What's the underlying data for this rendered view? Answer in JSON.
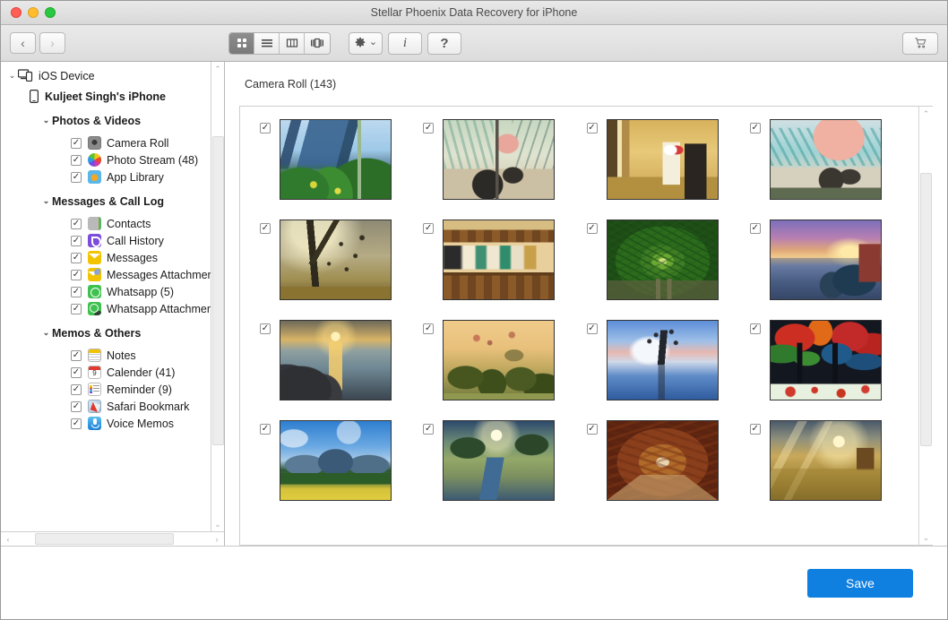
{
  "window": {
    "title": "Stellar Phoenix Data Recovery for iPhone",
    "traffic_lights": [
      "close-red",
      "minimize-yellow",
      "maximize-green"
    ]
  },
  "toolbar": {
    "back_label": "‹",
    "forward_label": "›",
    "view_modes": [
      {
        "name": "icon-view",
        "icon": "grid-icon",
        "active": true
      },
      {
        "name": "list-view",
        "icon": "list-icon",
        "active": false
      },
      {
        "name": "column-view",
        "icon": "columns-icon",
        "active": false
      },
      {
        "name": "gallery-view",
        "icon": "coverflow-icon",
        "active": false
      }
    ],
    "gear_label": "⚙",
    "gear_chevron": "⌄",
    "info_label": "i",
    "help_label": "?",
    "cart_icon": "shopping-cart-icon"
  },
  "sidebar": {
    "root": {
      "label": "iOS Device",
      "icon": "devices-icon",
      "disclosure": "⌄"
    },
    "device": {
      "label": "Kuljeet Singh's iPhone",
      "icon": "iphone-icon"
    },
    "groups": [
      {
        "label": "Photos & Videos",
        "disclosure": "⌄",
        "items": [
          {
            "label": "Camera Roll",
            "icon": "camera-roll-icon",
            "checked": true,
            "check": "✓"
          },
          {
            "label": "Photo Stream (48)",
            "icon": "photo-stream-icon",
            "checked": true,
            "check": "✓"
          },
          {
            "label": "App Library",
            "icon": "app-library-icon",
            "checked": true,
            "check": "✓"
          }
        ]
      },
      {
        "label": "Messages & Call Log",
        "disclosure": "⌄",
        "items": [
          {
            "label": "Contacts",
            "icon": "contacts-icon",
            "checked": true,
            "check": "✓"
          },
          {
            "label": "Call History",
            "icon": "call-history-icon",
            "checked": true,
            "check": "✓"
          },
          {
            "label": "Messages",
            "icon": "messages-icon",
            "checked": true,
            "check": "✓"
          },
          {
            "label": "Messages Attachments",
            "icon": "messages-attachments-icon",
            "checked": true,
            "check": "✓"
          },
          {
            "label": "Whatsapp (5)",
            "icon": "whatsapp-icon",
            "checked": true,
            "check": "✓"
          },
          {
            "label": "Whatsapp Attachments",
            "icon": "whatsapp-attachments-icon",
            "checked": true,
            "check": "✓"
          }
        ]
      },
      {
        "label": "Memos & Others",
        "disclosure": "⌄",
        "items": [
          {
            "label": "Notes",
            "icon": "notes-icon",
            "checked": true,
            "check": "✓"
          },
          {
            "label": "Calender (41)",
            "icon": "calendar-icon",
            "checked": true,
            "check": "✓"
          },
          {
            "label": "Reminder (9)",
            "icon": "reminder-icon",
            "checked": true,
            "check": "✓"
          },
          {
            "label": "Safari Bookmark",
            "icon": "safari-icon",
            "checked": true,
            "check": "✓"
          },
          {
            "label": "Voice Memos",
            "icon": "voice-memos-icon",
            "checked": true,
            "check": "✓"
          }
        ]
      }
    ],
    "scroll": {
      "up_arrow": "⌃",
      "down_arrow": "⌄",
      "left_arrow": "‹",
      "right_arrow": "›"
    }
  },
  "main": {
    "header_title": "Camera Roll (143)",
    "scroll": {
      "up_arrow": "⌃",
      "down_arrow": "⌄"
    },
    "thumbnails": [
      {
        "alt": "blue glass office building with greenery",
        "check": "✓"
      },
      {
        "alt": "glass atrium terrace with tables and pink umbrella",
        "check": "✓"
      },
      {
        "alt": "warm lit office room with desk and chair",
        "check": "✓"
      },
      {
        "alt": "rooftop patio with pink umbrella and chairs",
        "check": "✓"
      },
      {
        "alt": "sunlit tree with falling leaves in mist",
        "check": "✓"
      },
      {
        "alt": "wooden shelf with ceramic vases",
        "check": "✓"
      },
      {
        "alt": "green tunnel of trees over railway track",
        "check": "✓"
      },
      {
        "alt": "fishing boats at sunset on purple water",
        "check": "✓"
      },
      {
        "alt": "golden sunset over rocky sea shore",
        "check": "✓"
      },
      {
        "alt": "hot air balloons over misty temple valley",
        "check": "✓"
      },
      {
        "alt": "bare tree in blue lake under pink sky",
        "check": "✓"
      },
      {
        "alt": "vivid red and blue autumn trees painting",
        "check": "✓"
      },
      {
        "alt": "mountain under blue sky with yellow field",
        "check": "✓"
      },
      {
        "alt": "winding river through green valley at sunrise",
        "check": "✓"
      },
      {
        "alt": "autumn path lined with orange trees",
        "check": "✓"
      },
      {
        "alt": "sun rays over golden wheat field",
        "check": "✓"
      }
    ]
  },
  "footer": {
    "save_label": "Save"
  },
  "colors": {
    "accent": "#0f7fe0",
    "titlebar": "#e2e2e2",
    "toolbar": "#e3e3e3",
    "sidebar_bg": "#ffffff",
    "text": "#1c1c1c"
  }
}
